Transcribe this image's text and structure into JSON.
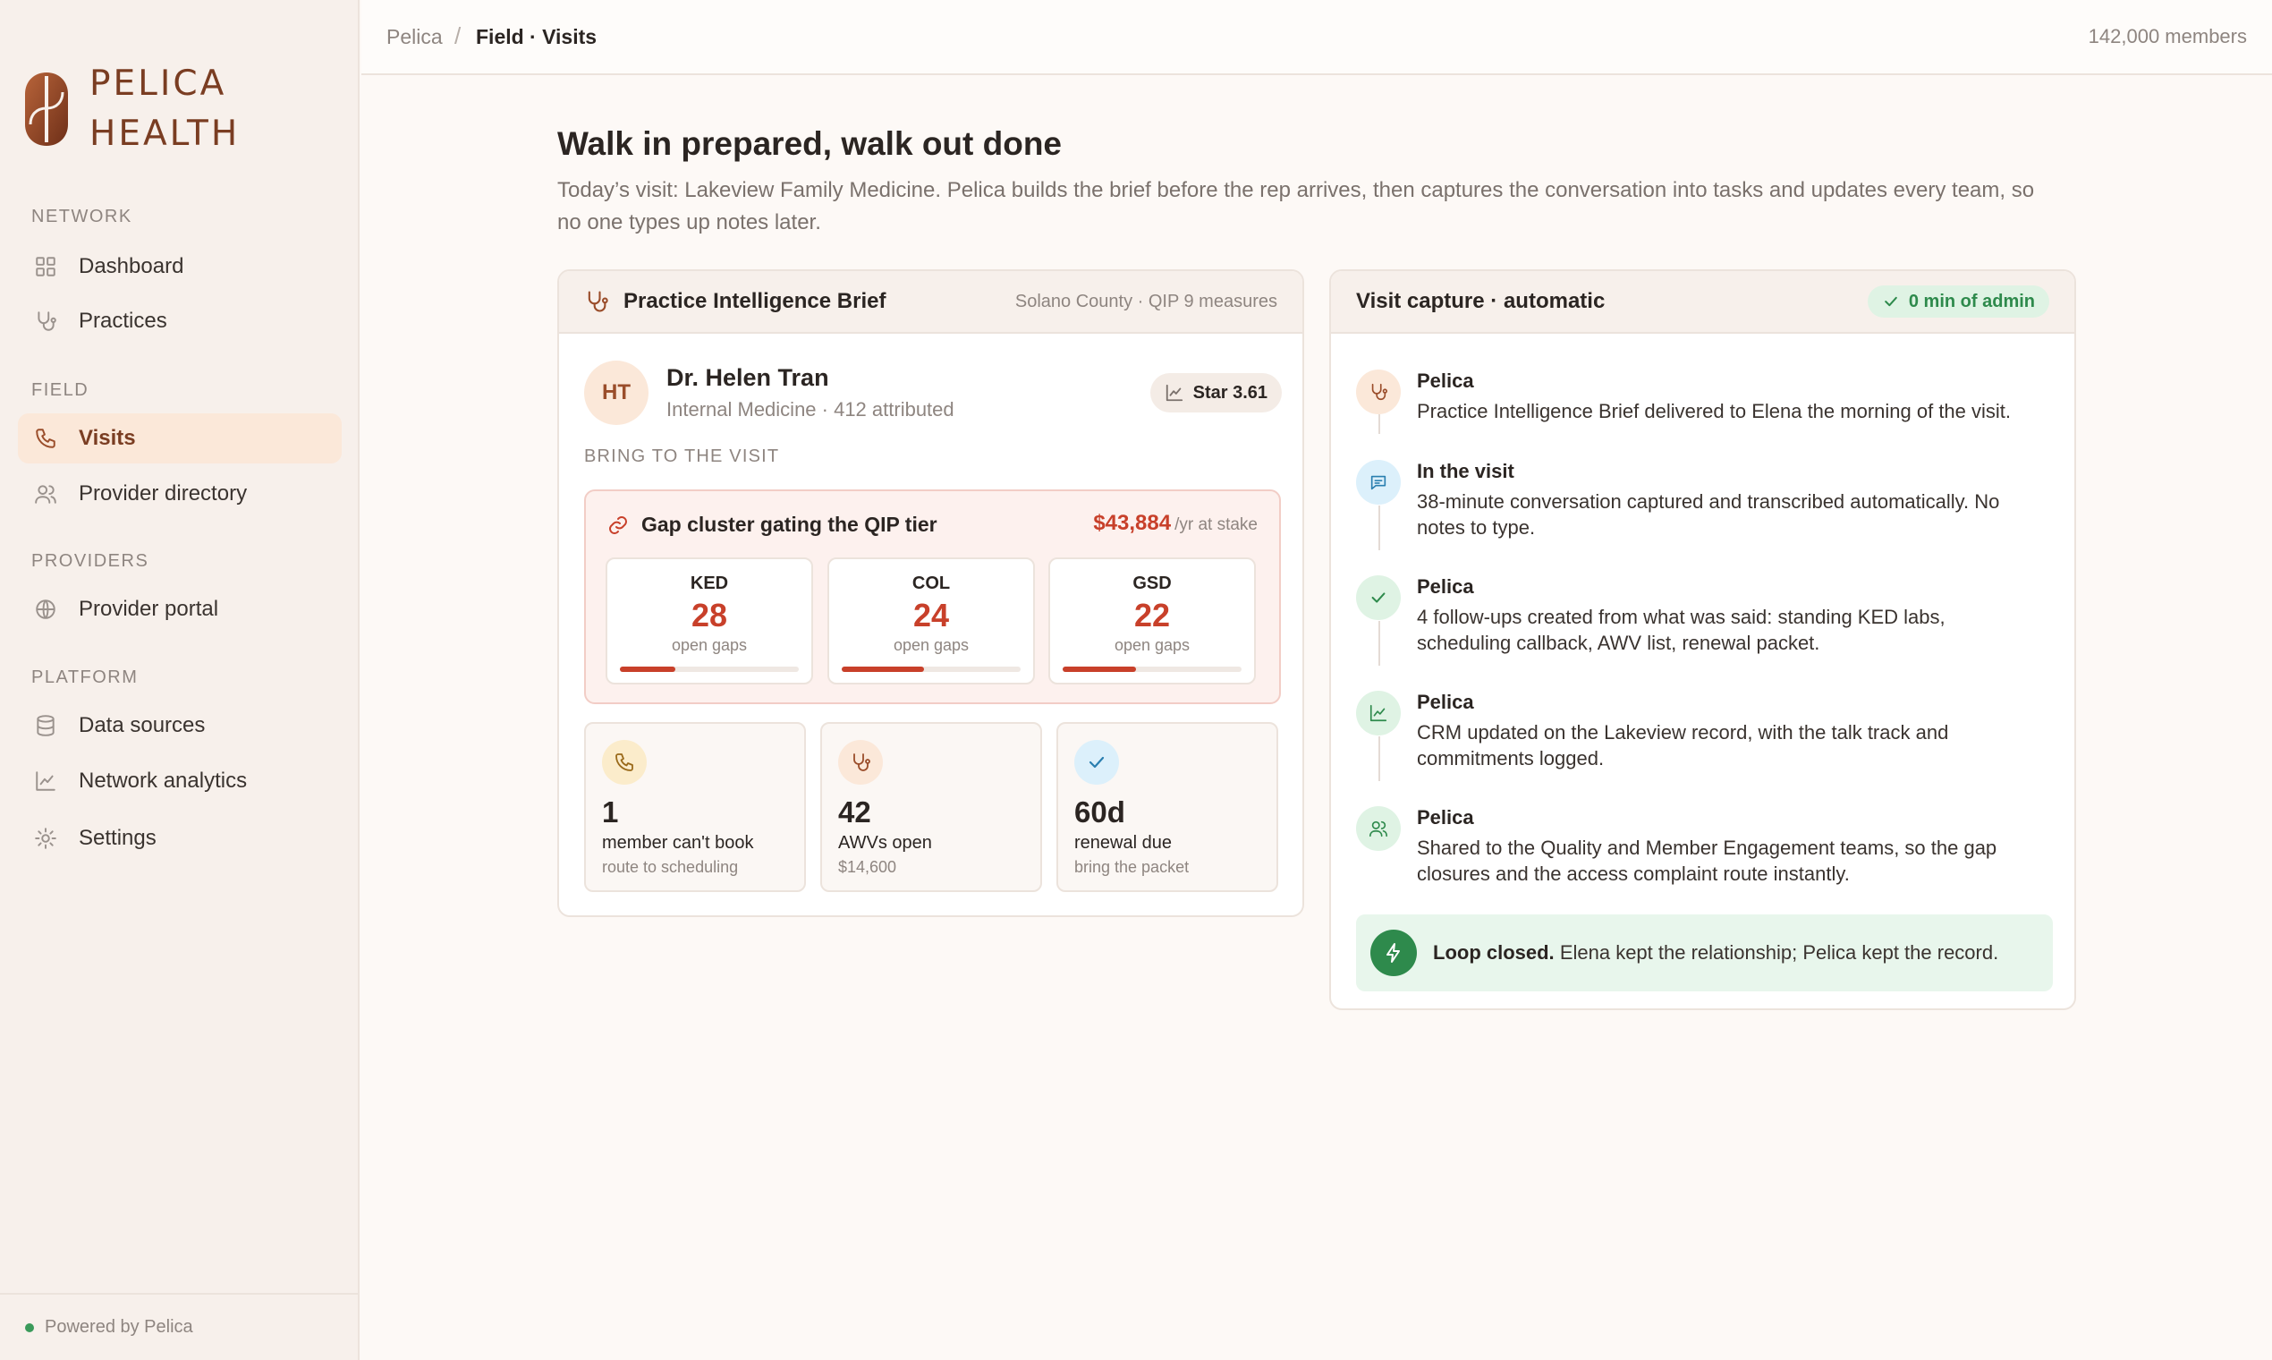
{
  "brand": {
    "line1": "PELICA",
    "line2": "HEALTH"
  },
  "sidebar": {
    "sections": [
      {
        "label": "NETWORK"
      },
      {
        "label": "FIELD"
      },
      {
        "label": "PROVIDERS"
      },
      {
        "label": "PLATFORM"
      }
    ],
    "items": [
      {
        "label": "Dashboard",
        "icon": "grid-icon"
      },
      {
        "label": "Practices",
        "icon": "stethoscope-icon"
      },
      {
        "label": "Visits",
        "icon": "phone-icon",
        "active": true
      },
      {
        "label": "Provider directory",
        "icon": "users-icon"
      },
      {
        "label": "Provider portal",
        "icon": "globe-icon"
      },
      {
        "label": "Data sources",
        "icon": "database-icon"
      },
      {
        "label": "Network analytics",
        "icon": "chart-line-icon"
      },
      {
        "label": "Settings",
        "icon": "gear-icon"
      }
    ],
    "footer": "Powered by Pelica"
  },
  "topbar": {
    "breadcrumb_root": "Pelica",
    "breadcrumb_sep": "/",
    "breadcrumb_current": "Field · Visits",
    "members": "142,000 members"
  },
  "page": {
    "title": "Walk in prepared, walk out done",
    "description": "Today’s visit: Lakeview Family Medicine. Pelica builds the brief before the rep arrives, then captures the conversation into tasks and updates every team, so no one types up notes later."
  },
  "brief": {
    "title": "Practice Intelligence Brief",
    "meta": "Solano County · QIP 9 measures",
    "doctor": {
      "initials": "HT",
      "name": "Dr. Helen Tran",
      "sub": "Internal Medicine · 412 attributed",
      "star": "Star 3.61"
    },
    "bring_label": "BRING TO THE VISIT",
    "gap": {
      "title": "Gap cluster gating the QIP tier",
      "value": "$43,884",
      "value_suffix": "/yr at stake",
      "measures": [
        {
          "code": "KED",
          "value": "28",
          "sub": "open gaps",
          "progress": 0.31
        },
        {
          "code": "COL",
          "value": "24",
          "sub": "open gaps",
          "progress": 0.46
        },
        {
          "code": "GSD",
          "value": "22",
          "sub": "open gaps",
          "progress": 0.41
        }
      ]
    },
    "stats": [
      {
        "value": "1",
        "label": "member can't book",
        "sub": "route to scheduling",
        "icon": "phone-icon"
      },
      {
        "value": "42",
        "label": "AWVs open",
        "sub": "$14,600",
        "icon": "stethoscope-icon"
      },
      {
        "value": "60d",
        "label": "renewal due",
        "sub": "bring the packet",
        "icon": "check-icon"
      }
    ]
  },
  "capture": {
    "title": "Visit capture · automatic",
    "badge": "0 min of admin",
    "timeline": [
      {
        "who": "Pelica",
        "text": "Practice Intelligence Brief delivered to Elena the morning of the visit.",
        "icon": "stethoscope-icon"
      },
      {
        "who": "In the visit",
        "text": "38-minute conversation captured and transcribed automatically. No notes to type.",
        "icon": "chat-icon"
      },
      {
        "who": "Pelica",
        "text": "4 follow-ups created from what was said: standing KED labs, scheduling callback, AWV list, renewal packet.",
        "icon": "check-icon"
      },
      {
        "who": "Pelica",
        "text": "CRM updated on the Lakeview record, with the talk track and commitments logged.",
        "icon": "chart-line-icon"
      },
      {
        "who": "Pelica",
        "text": "Shared to the Quality and Member Engagement teams, so the gap closures and the access complaint route instantly.",
        "icon": "users-icon"
      }
    ],
    "loop_bold": "Loop closed.",
    "loop_text": "Elena kept the relationship; Pelica kept the record."
  },
  "colors": {
    "accent": "#9a4d2a",
    "danger": "#c8402a",
    "success": "#2e8a4c",
    "sidebar_bg": "#f7f0eb"
  }
}
